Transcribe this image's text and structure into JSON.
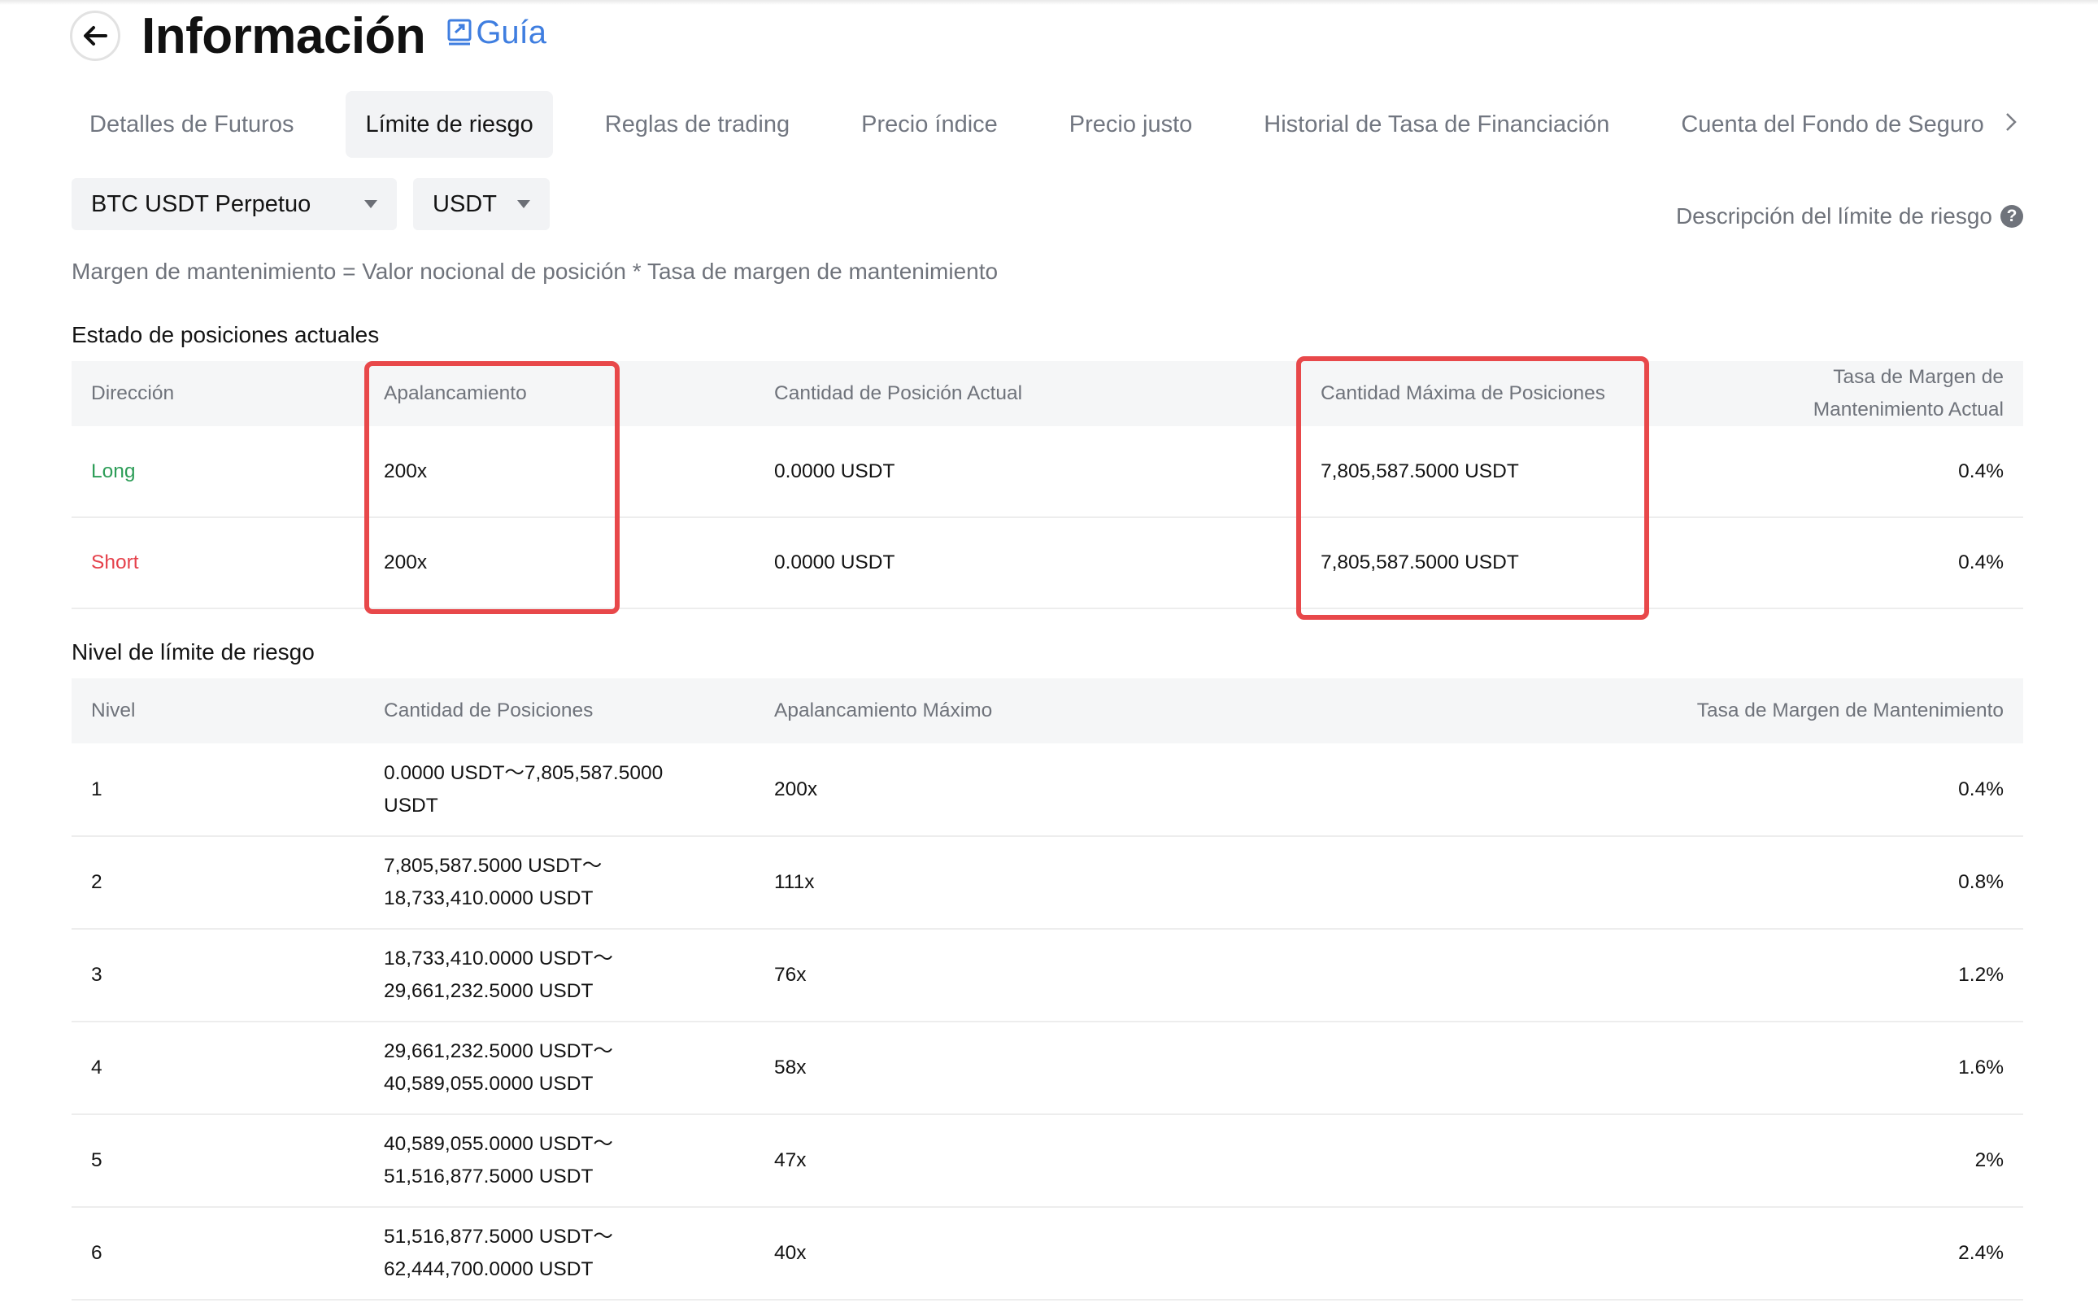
{
  "page": {
    "title": "Información",
    "guide_label": "Guía"
  },
  "tabs": [
    {
      "label": "Detalles de Futuros",
      "active": false
    },
    {
      "label": "Límite de riesgo",
      "active": true
    },
    {
      "label": "Reglas de trading",
      "active": false
    },
    {
      "label": "Precio índice",
      "active": false
    },
    {
      "label": "Precio justo",
      "active": false
    },
    {
      "label": "Historial de Tasa de Financiación",
      "active": false
    },
    {
      "label": "Cuenta del Fondo de Seguro",
      "active": false
    }
  ],
  "filters": {
    "pair": "BTC USDT Perpetuo",
    "currency": "USDT"
  },
  "risk_limit_description": "Descripción del límite de riesgo",
  "formula": "Margen de mantenimiento = Valor nocional de posición * Tasa de margen de mantenimiento",
  "current_positions": {
    "title": "Estado de posiciones actuales",
    "headers": {
      "direction": "Dirección",
      "leverage": "Apalancamiento",
      "current_qty": "Cantidad de Posición Actual",
      "max_qty": "Cantidad Máxima de Posiciones",
      "mmr_line1": "Tasa de Margen de",
      "mmr_line2": "Mantenimiento Actual"
    },
    "rows": [
      {
        "direction": "Long",
        "leverage": "200x",
        "current_qty": "0.0000 USDT",
        "max_qty": "7,805,587.5000 USDT",
        "mmr": "0.4%"
      },
      {
        "direction": "Short",
        "leverage": "200x",
        "current_qty": "0.0000 USDT",
        "max_qty": "7,805,587.5000 USDT",
        "mmr": "0.4%"
      }
    ]
  },
  "risk_levels": {
    "title": "Nivel de límite de riesgo",
    "headers": {
      "level": "Nivel",
      "qty": "Cantidad de Posiciones",
      "max_leverage": "Apalancamiento Máximo",
      "mmr": "Tasa de Margen de Mantenimiento"
    },
    "rows": [
      {
        "level": "1",
        "qty_line1": "0.0000 USDT～7,805,587.5000",
        "qty_line2": "USDT",
        "max_leverage": "200x",
        "mmr": "0.4%"
      },
      {
        "level": "2",
        "qty_line1": "7,805,587.5000 USDT～",
        "qty_line2": "18,733,410.0000 USDT",
        "max_leverage": "111x",
        "mmr": "0.8%"
      },
      {
        "level": "3",
        "qty_line1": "18,733,410.0000 USDT～",
        "qty_line2": "29,661,232.5000 USDT",
        "max_leverage": "76x",
        "mmr": "1.2%"
      },
      {
        "level": "4",
        "qty_line1": "29,661,232.5000 USDT～",
        "qty_line2": "40,589,055.0000 USDT",
        "max_leverage": "58x",
        "mmr": "1.6%"
      },
      {
        "level": "5",
        "qty_line1": "40,589,055.0000 USDT～",
        "qty_line2": "51,516,877.5000 USDT",
        "max_leverage": "47x",
        "mmr": "2%"
      },
      {
        "level": "6",
        "qty_line1": "51,516,877.5000 USDT～",
        "qty_line2": "62,444,700.0000 USDT",
        "max_leverage": "40x",
        "mmr": "2.4%"
      }
    ]
  },
  "colors": {
    "accent": "#3f7ee0",
    "long": "#2d9d58",
    "short": "#e5414b",
    "highlight": "#e8484a"
  }
}
